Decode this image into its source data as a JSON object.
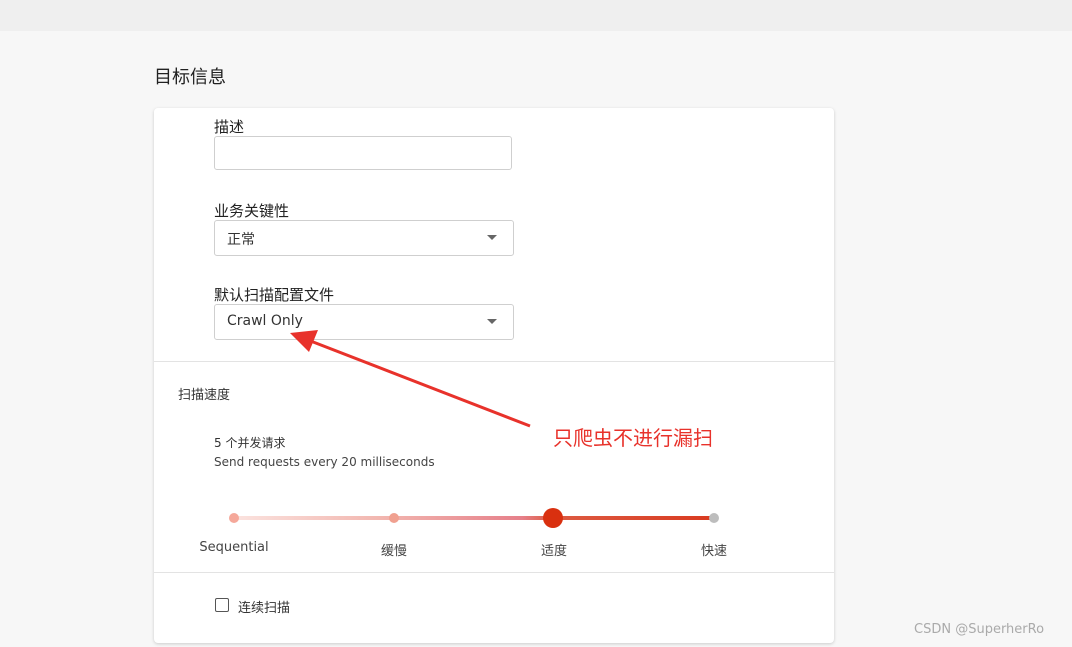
{
  "section": {
    "title": "目标信息"
  },
  "fields": {
    "description": {
      "label": "描述",
      "value": ""
    },
    "criticality": {
      "label": "业务关键性",
      "value": "正常"
    },
    "scan_profile": {
      "label": "默认扫描配置文件",
      "value": "Crawl Only"
    }
  },
  "scan_speed": {
    "title": "扫描速度",
    "concurrency": "5 个并发请求",
    "description": "Send requests every 20 milliseconds",
    "levels": [
      "Sequential",
      "缓慢",
      "适度",
      "快速"
    ],
    "selected": "适度"
  },
  "continuous_scan": {
    "label": "连续扫描",
    "checked": false
  },
  "annotation": {
    "text": "只爬虫不进行漏扫",
    "color": "#e8322b"
  },
  "watermark": "CSDN @SuperherRo"
}
